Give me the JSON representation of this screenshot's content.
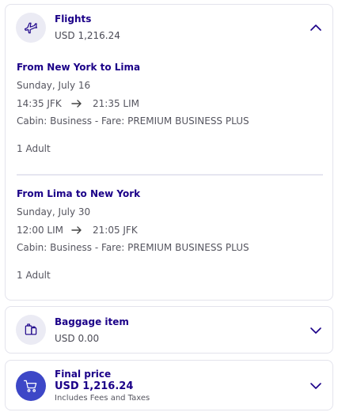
{
  "flights": {
    "title": "Flights",
    "price": "USD 1,216.24",
    "segments": [
      {
        "route": "From New York to Lima",
        "date": "Sunday, July 16",
        "depart": "14:35 JFK",
        "arrive": "21:35 LIM",
        "cabin": "Cabin: Business - Fare: PREMIUM BUSINESS PLUS",
        "passengers": "1 Adult"
      },
      {
        "route": "From Lima to New York",
        "date": "Sunday, July 30",
        "depart": "12:00 LIM",
        "arrive": "21:05 JFK",
        "cabin": "Cabin: Business - Fare: PREMIUM BUSINESS PLUS",
        "passengers": "1 Adult"
      }
    ]
  },
  "baggage": {
    "title": "Baggage item",
    "price": "USD 0.00"
  },
  "final": {
    "title": "Final price",
    "price": "USD 1,216.24",
    "note": "Includes Fees and Taxes"
  },
  "colors": {
    "brand": "#1b0088",
    "accent": "#3d47c7",
    "icon_bg": "#ebebf4"
  },
  "icons": [
    "airplane-icon",
    "chevron-up-icon",
    "arrow-right-icon",
    "luggage-icon",
    "chevron-down-icon",
    "cart-icon"
  ]
}
